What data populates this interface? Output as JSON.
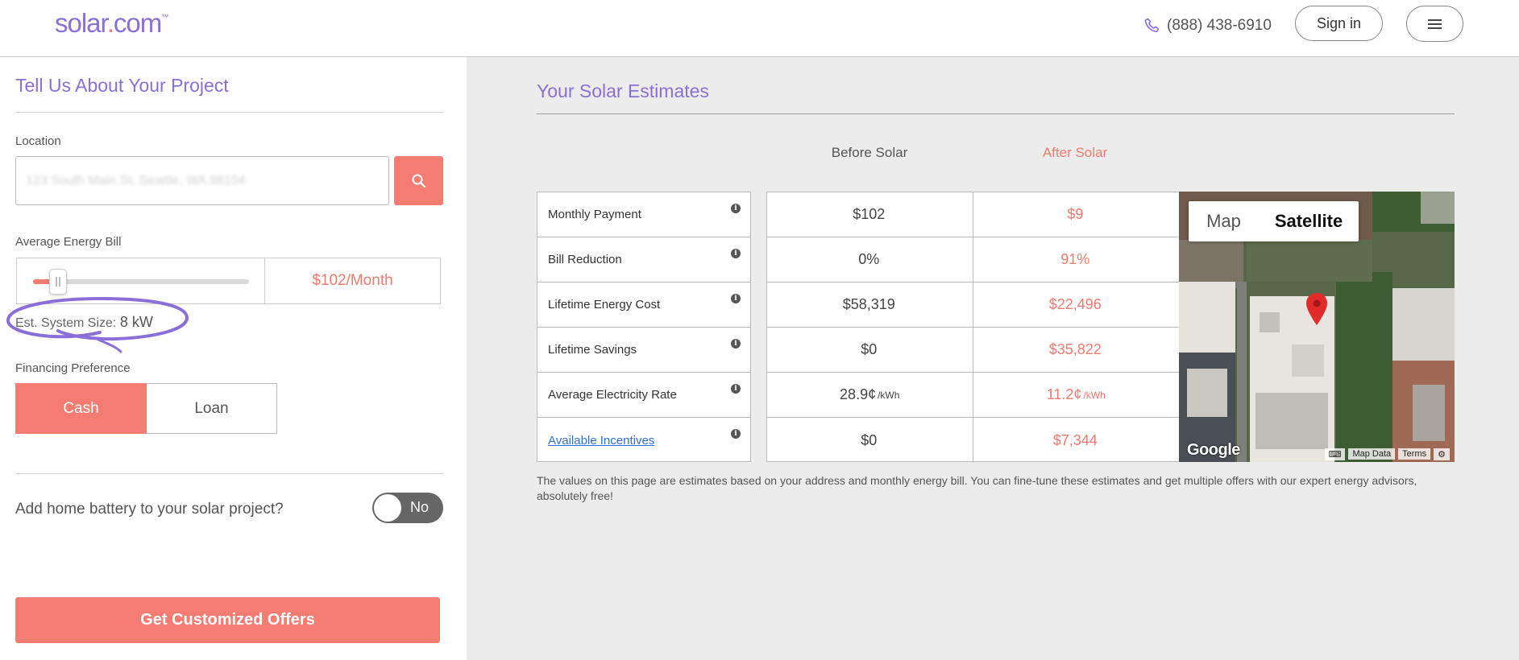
{
  "header": {
    "logo_main": "solar",
    "logo_dot": ".",
    "logo_com": "com",
    "logo_tm": "™",
    "phone": "(888) 438-6910",
    "signin_label": "Sign in"
  },
  "left": {
    "title": "Tell Us About Your Project",
    "location_label": "Location",
    "location_value": "123 South Main St, Seattle, WA 98104",
    "bill_label": "Average Energy Bill",
    "bill_value": "$102/Month",
    "bill_fraction": 0.09,
    "system_size_label": "Est. System Size: ",
    "system_size_value": "8 kW",
    "financing_label": "Financing Preference",
    "financing_options": [
      "Cash",
      "Loan"
    ],
    "battery_question": "Add home battery to your solar project?",
    "battery_toggle": "No",
    "cta_label": "Get Customized Offers"
  },
  "estimates": {
    "title": "Your Solar Estimates",
    "before_label": "Before Solar",
    "after_label": "After Solar",
    "rows": [
      {
        "label": "Monthly Payment",
        "before": "$102",
        "before_unit": "",
        "after": "$9",
        "after_unit": ""
      },
      {
        "label": "Bill Reduction",
        "before": "0%",
        "before_unit": "",
        "after": "91%",
        "after_unit": ""
      },
      {
        "label": "Lifetime Energy Cost",
        "before": "$58,319",
        "before_unit": "",
        "after": "$22,496",
        "after_unit": ""
      },
      {
        "label": "Lifetime Savings",
        "before": "$0",
        "before_unit": "",
        "after": "$35,822",
        "after_unit": ""
      },
      {
        "label": "Average Electricity Rate",
        "before": "28.9¢",
        "before_unit": "/kWh",
        "after": "11.2¢",
        "after_unit": "/kWh"
      },
      {
        "label": "Available Incentives",
        "before": "$0",
        "before_unit": "",
        "after": "$7,344",
        "after_unit": ""
      }
    ],
    "info_glyph": "i",
    "map": {
      "map_label": "Map",
      "satellite_label": "Satellite",
      "google": "Google",
      "map_data": "Map Data",
      "terms": "Terms"
    },
    "disclaimer": "The values on this page are estimates based on your address and monthly energy bill. You can fine-tune these estimates and get multiple offers with our expert energy advisors, absolutely free!"
  },
  "colors": {
    "accent_purple": "#8b6fd9",
    "accent_coral": "#f47c72"
  }
}
